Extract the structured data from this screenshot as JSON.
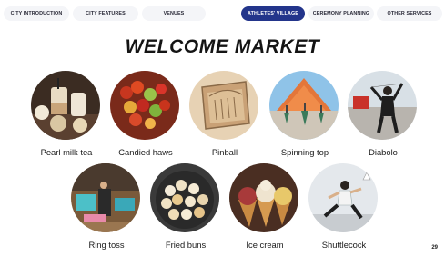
{
  "nav": {
    "tabs": [
      {
        "label": "CITY INTRODUCTION",
        "active": false
      },
      {
        "label": "CITY FEATURES",
        "active": false
      },
      {
        "label": "VENUES",
        "active": false
      },
      {
        "label": "ATHLETES' VILLAGE",
        "active": true
      },
      {
        "label": "CEREMONY PLANNING",
        "active": false
      },
      {
        "label": "OTHER SERVICES",
        "active": false
      }
    ]
  },
  "title": "WELCOME MARKET",
  "items": [
    {
      "label": "Pearl milk tea"
    },
    {
      "label": "Candied haws"
    },
    {
      "label": "Pinball"
    },
    {
      "label": "Spinning top"
    },
    {
      "label": "Diabolo"
    },
    {
      "label": "Ring toss"
    },
    {
      "label": "Fried buns"
    },
    {
      "label": "Ice cream"
    },
    {
      "label": "Shuttlecock"
    }
  ],
  "page_number": "29",
  "colors": {
    "accent": "#23358b",
    "tab_bg": "#f4f5f8"
  }
}
